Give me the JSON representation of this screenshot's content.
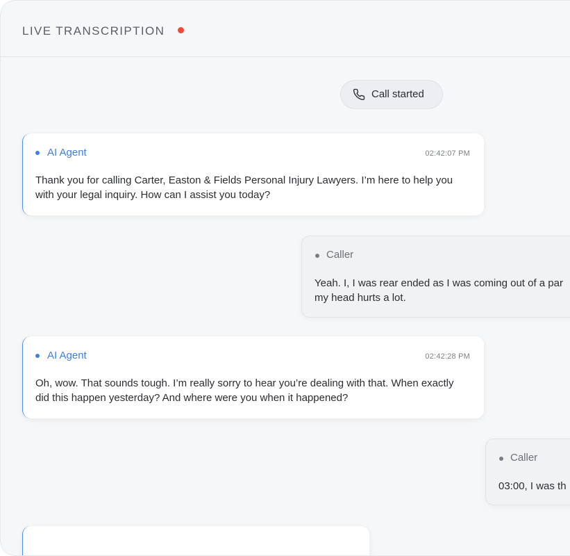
{
  "header": {
    "title": "LIVE TRANSCRIPTION",
    "live_color": "#ea4b3a"
  },
  "call_event": {
    "icon": "phone-icon",
    "label": "Call started"
  },
  "messages": [
    {
      "speaker": "AI Agent",
      "timestamp": "02:42:07 PM",
      "text": "Thank you for calling Carter, Easton & Fields Personal Injury Lawyers. I’m here to help you with your legal inquiry. How can I assist you today?"
    },
    {
      "speaker": "Caller",
      "timestamp": "",
      "text_lines": [
        "Yeah. I, I was rear ended as I was coming out of a par",
        "my head hurts a lot."
      ]
    },
    {
      "speaker": "AI Agent",
      "timestamp": "02:42:28 PM",
      "text": "Oh, wow. That sounds tough. I’m really sorry to hear you’re dealing with that. When exactly did this happen yesterday? And where were you when it happened?"
    },
    {
      "speaker": "Caller",
      "timestamp": "",
      "text_lines": [
        "03:00, I was th"
      ]
    }
  ],
  "colors": {
    "agent_accent": "#3d7fe6",
    "caller_accent": "#7a7d85",
    "background": "#f6f7f9"
  }
}
